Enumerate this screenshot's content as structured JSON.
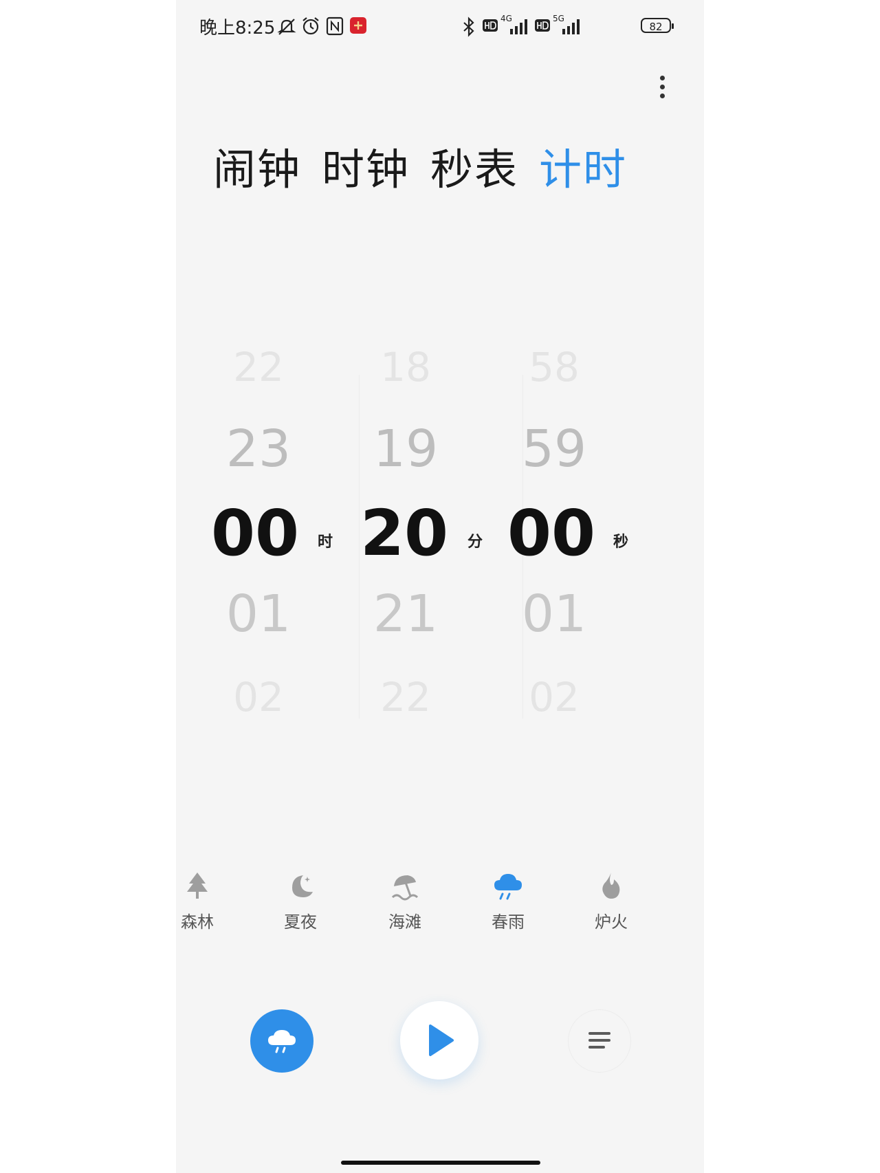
{
  "status_bar": {
    "time": "晚上8:25",
    "network_1": "4G",
    "network_2": "5G",
    "battery": "82"
  },
  "tabs": [
    {
      "label": "闹钟",
      "active": false
    },
    {
      "label": "时钟",
      "active": false
    },
    {
      "label": "秒表",
      "active": false
    },
    {
      "label": "计时",
      "active": true
    }
  ],
  "picker": {
    "hours": {
      "prev2": "22",
      "prev1": "23",
      "current": "00",
      "next1": "01",
      "next2": "02",
      "unit": "时"
    },
    "minutes": {
      "prev2": "18",
      "prev1": "19",
      "current": "20",
      "next1": "21",
      "next2": "22",
      "unit": "分"
    },
    "seconds": {
      "prev2": "58",
      "prev1": "59",
      "current": "00",
      "next1": "01",
      "next2": "02",
      "unit": "秒"
    }
  },
  "scenes": [
    {
      "label": "森林",
      "icon": "tree-icon"
    },
    {
      "label": "夏夜",
      "icon": "moon-icon"
    },
    {
      "label": "海滩",
      "icon": "beach-umbrella-icon"
    },
    {
      "label": "春雨",
      "icon": "rain-cloud-icon",
      "active": true
    },
    {
      "label": "炉火",
      "icon": "flame-icon"
    }
  ],
  "colors": {
    "accent": "#2f8fe8",
    "background": "#f5f5f5",
    "text": "#1a1a1a"
  }
}
